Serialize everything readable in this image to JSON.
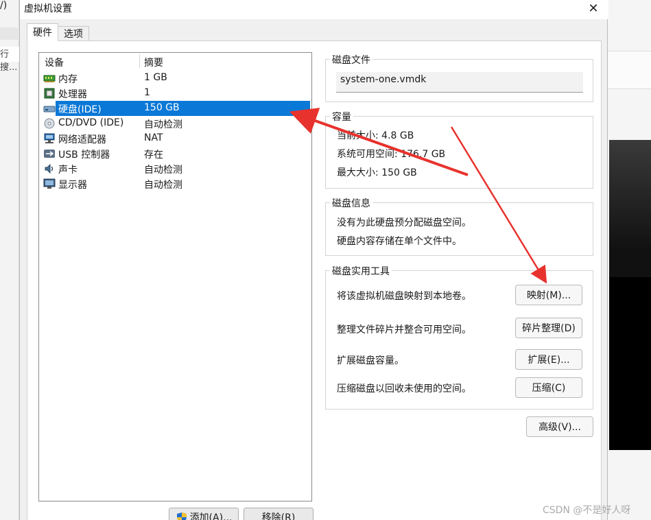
{
  "background": {
    "left_fragment_1": "/)",
    "left_fragment_2": "行搜..."
  },
  "window": {
    "title": "虚拟机设置"
  },
  "tabs": [
    {
      "label": "硬件"
    },
    {
      "label": "选项"
    }
  ],
  "device_list": {
    "columns": [
      "设备",
      "摘要"
    ],
    "rows": [
      {
        "name": "内存",
        "summary": "1 GB",
        "icon": "memory-icon"
      },
      {
        "name": "处理器",
        "summary": "1",
        "icon": "cpu-icon"
      },
      {
        "name": "硬盘(IDE)",
        "summary": "150 GB",
        "icon": "harddisk-icon",
        "selected": true
      },
      {
        "name": "CD/DVD (IDE)",
        "summary": "自动检测",
        "icon": "cd-icon"
      },
      {
        "name": "网络适配器",
        "summary": "NAT",
        "icon": "network-icon"
      },
      {
        "name": "USB 控制器",
        "summary": "存在",
        "icon": "usb-icon"
      },
      {
        "name": "声卡",
        "summary": "自动检测",
        "icon": "sound-icon"
      },
      {
        "name": "显示器",
        "summary": "自动检测",
        "icon": "display-icon"
      }
    ],
    "add_button": "添加(A)...",
    "remove_button": "移除(R)"
  },
  "disk_file": {
    "title": "磁盘文件",
    "value": "system-one.vmdk"
  },
  "capacity": {
    "title": "容量",
    "current_size": "当前大小: 4.8 GB",
    "system_free": "系统可用空间: 176.7 GB",
    "max_size": "最大大小: 150 GB"
  },
  "disk_info": {
    "title": "磁盘信息",
    "line1": "没有为此硬盘预分配磁盘空间。",
    "line2": "硬盘内容存储在单个文件中。"
  },
  "disk_utilities": {
    "title": "磁盘实用工具",
    "items": [
      {
        "desc": "将该虚拟机磁盘映射到本地卷。",
        "button": "映射(M)..."
      },
      {
        "desc": "整理文件碎片并整合可用空间。",
        "button": "碎片整理(D)"
      },
      {
        "desc": "扩展磁盘容量。",
        "button": "扩展(E)..."
      },
      {
        "desc": "压缩磁盘以回收未使用的空间。",
        "button": "压缩(C)"
      }
    ]
  },
  "advanced_button": "高级(V)...",
  "watermark": "CSDN @不是好人呀",
  "annotation_color": "#e8322d"
}
